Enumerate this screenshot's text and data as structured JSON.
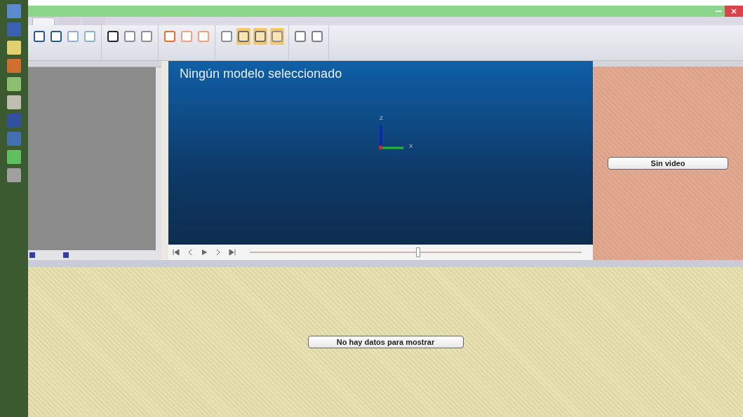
{
  "ribbon": {
    "tabs": [
      {
        "selected": true
      },
      {
        "selected": false
      },
      {
        "selected": false
      }
    ],
    "groups": [
      {
        "buttons": [
          {
            "color": "#2a5a8a",
            "selected": false
          },
          {
            "color": "#2a5a8a",
            "selected": false
          },
          {
            "color": "#8fb0d0",
            "selected": false
          },
          {
            "color": "#8fb0d0",
            "selected": false
          }
        ]
      },
      {
        "buttons": [
          {
            "color": "#1e2a3a",
            "selected": false
          },
          {
            "color": "#8a9099",
            "selected": false
          },
          {
            "color": "#8a9099",
            "selected": false
          }
        ]
      },
      {
        "buttons": [
          {
            "color": "#e8702a",
            "selected": false
          },
          {
            "color": "#f0a080",
            "selected": false
          },
          {
            "color": "#f0a080",
            "selected": false
          }
        ]
      },
      {
        "buttons": [
          {
            "color": "#8a9099",
            "selected": false
          },
          {
            "color": "#6a7079",
            "selected": true
          },
          {
            "color": "#6a7079",
            "selected": true
          },
          {
            "color": "#8a9099",
            "selected": true
          }
        ]
      },
      {
        "buttons": [
          {
            "color": "#7a8089",
            "selected": false
          },
          {
            "color": "#7a8089",
            "selected": false
          }
        ]
      }
    ]
  },
  "viewer": {
    "title": "Ningún modelo seleccionado",
    "axes": {
      "z": "Z",
      "x": "X"
    },
    "player": {
      "level": 0.5
    }
  },
  "video": {
    "message": "Sin video"
  },
  "data_panel": {
    "message": "No hay datos para mostrar"
  }
}
